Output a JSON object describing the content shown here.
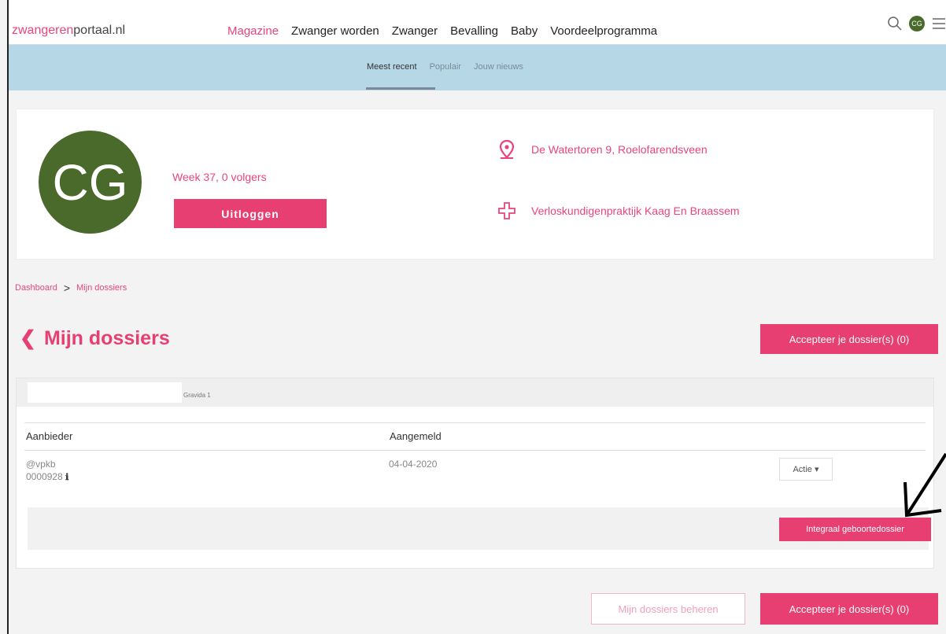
{
  "header": {
    "logo_part1": "zwangeren",
    "logo_part2": "portaal.nl",
    "nav": [
      "Magazine",
      "Zwanger worden",
      "Zwanger",
      "Bevalling",
      "Baby",
      "Voordeelprogramma"
    ],
    "active_nav": "Magazine",
    "avatar_initials": "CG"
  },
  "subnav": {
    "items": [
      "Meest recent",
      "Populair",
      "Jouw nieuws"
    ],
    "active": "Meest recent"
  },
  "profile": {
    "initials": "CG",
    "week_text": "Week 37, 0 volgers",
    "logout_label": "Uitloggen",
    "address": "De Watertoren 9, Roelofarendsveen",
    "practice": "Verloskundigenpraktijk Kaag En Braassem"
  },
  "breadcrumb": {
    "home": "Dashboard",
    "separator": ">",
    "current": "Mijn dossiers"
  },
  "page": {
    "title": "Mijn dossiers",
    "accept_label": "Accepteer je dossier(s) (0)",
    "manage_label": "Mijn dossiers beheren"
  },
  "panel": {
    "tab_label": "Gravida 1",
    "columns": [
      "Aanbieder",
      "Aangemeld"
    ],
    "row": {
      "provider": "@vpkb",
      "id": "0000928",
      "date": "04-04-2020",
      "action_label": "Actie ▾"
    },
    "integraal_label": "Integraal geboortedossier"
  },
  "colors": {
    "brand": "#e83f73",
    "subbar": "#b5d7e6",
    "avatar": "#4a6a2b"
  }
}
